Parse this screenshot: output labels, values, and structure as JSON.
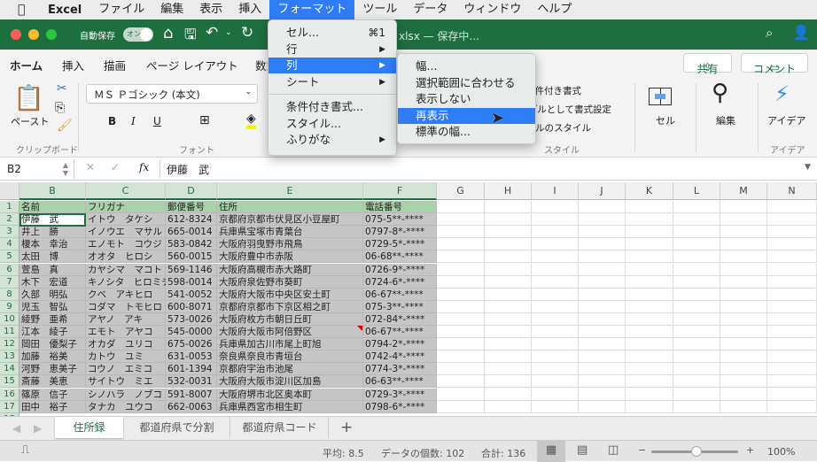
{
  "menubar": {
    "app": "Excel",
    "items": [
      "ファイル",
      "編集",
      "表示",
      "挿入",
      "フォーマット",
      "ツール",
      "データ",
      "ウィンドウ",
      "ヘルプ"
    ],
    "active": "フォーマット"
  },
  "titlebar": {
    "autosave": "自動保存",
    "toggle": "オン",
    "filename": "xlsx — 保存中...",
    "accent": "#1e6f40"
  },
  "ribbon_tabs": [
    "ホーム",
    "挿入",
    "描画",
    "ページ レイアウト",
    "数式"
  ],
  "ribbon": {
    "paste": "ペースト",
    "clipboard": "クリップボード",
    "font_name": "ＭＳ Ｐゴシック (本文)",
    "font_group": "フォント",
    "style_items": [
      "条件付き書式",
      "テーブルとして書式設定",
      "セルのスタイル"
    ],
    "style_group": "スタイル",
    "cells": "セル",
    "edit": "編集",
    "ideas": "アイデア",
    "ideas_group": "アイデア",
    "share": "共有",
    "comment": "コメント",
    "bold": "B",
    "italic": "I",
    "underline": "U"
  },
  "formula_bar": {
    "name_box": "B2",
    "fx": "fx",
    "value": "伊藤　武"
  },
  "format_menu": {
    "items": [
      {
        "label": "セル...",
        "shortcut": "⌘1"
      },
      {
        "label": "行",
        "sub": true
      },
      {
        "label": "列",
        "sub": true,
        "highlight": true
      },
      {
        "label": "シート",
        "sub": true
      },
      {
        "label": "条件付き書式..."
      },
      {
        "label": "スタイル..."
      },
      {
        "label": "ふりがな",
        "sub": true
      }
    ]
  },
  "column_submenu": {
    "items": [
      {
        "label": "幅..."
      },
      {
        "label": "選択範囲に合わせる"
      },
      {
        "label": "表示しない"
      },
      {
        "label": "再表示",
        "highlight": true
      },
      {
        "label": "標準の幅..."
      }
    ]
  },
  "columns": [
    "B",
    "C",
    "D",
    "E",
    "F",
    "G",
    "H",
    "I",
    "J",
    "K",
    "L",
    "M",
    "N"
  ],
  "rows": [
    [
      "名前",
      "フリガナ",
      "郵便番号",
      "住所",
      "電話番号"
    ],
    [
      "伊藤　武",
      "イトウ　タケシ",
      "612-8324",
      "京都府京都市伏見区小豆屋町",
      "075-5**-****"
    ],
    [
      "井上　勝",
      "イノウエ　マサル",
      "665-0014",
      "兵庫県宝塚市青葉台",
      "0797-8*-****"
    ],
    [
      "榎本　幸治",
      "エノモト　コウジ",
      "583-0842",
      "大阪府羽曳野市飛鳥",
      "0729-5*-****"
    ],
    [
      "太田　博",
      "オオタ　ヒロシ",
      "560-0015",
      "大阪府豊中市赤阪",
      "06-68**-****"
    ],
    [
      "萱島　真",
      "カヤシマ　マコト",
      "569-1146",
      "大阪府高槻市赤大路町",
      "0726-9*-****"
    ],
    [
      "木下　宏道",
      "キノシタ　ヒロミチ",
      "598-0014",
      "大阪府泉佐野市葵町",
      "0724-6*-****"
    ],
    [
      "久部　明弘",
      "クベ　アキヒロ",
      "541-0052",
      "大阪府大阪市中央区安土町",
      "06-67**-****"
    ],
    [
      "児玉　智弘",
      "コダマ　トモヒロ",
      "600-8071",
      "京都府京都市下京区相之町",
      "075-3**-****"
    ],
    [
      "綾野　亜希",
      "アヤノ　アキ",
      "573-0026",
      "大阪府枚方市朝日丘町",
      "072-84*-****"
    ],
    [
      "江本　綾子",
      "エモト　アヤコ",
      "545-0000",
      "大阪府大阪市阿倍野区",
      "06-67**-****"
    ],
    [
      "岡田　優梨子",
      "オカダ　ユリコ",
      "675-0026",
      "兵庫県加古川市尾上町旭",
      "0794-2*-****"
    ],
    [
      "加藤　裕美",
      "カトウ　ユミ",
      "631-0053",
      "奈良県奈良市青垣台",
      "0742-4*-****"
    ],
    [
      "河野　恵美子",
      "コウノ　エミコ",
      "601-1394",
      "京都府宇治市池尾",
      "0774-3*-****"
    ],
    [
      "斎藤　美恵",
      "サイトウ　ミエ",
      "532-0031",
      "大阪府大阪市淀川区加島",
      "06-63**-****"
    ],
    [
      "篠原　信子",
      "シノハラ　ノブコ",
      "591-8007",
      "大阪府堺市北区奥本町",
      "0729-3*-****"
    ],
    [
      "田中　裕子",
      "タナカ　ユウコ",
      "662-0063",
      "兵庫県西宮市相生町",
      "0798-6*-****"
    ]
  ],
  "sheets": [
    "住所録",
    "都道府県で分割",
    "都道府県コード"
  ],
  "active_sheet": "住所録",
  "add_sheet": "+",
  "status": {
    "average": "平均: 8.5",
    "count": "データの個数: 102",
    "sum": "合計: 136",
    "zoom": "100%",
    "zoom_percent": 100
  }
}
